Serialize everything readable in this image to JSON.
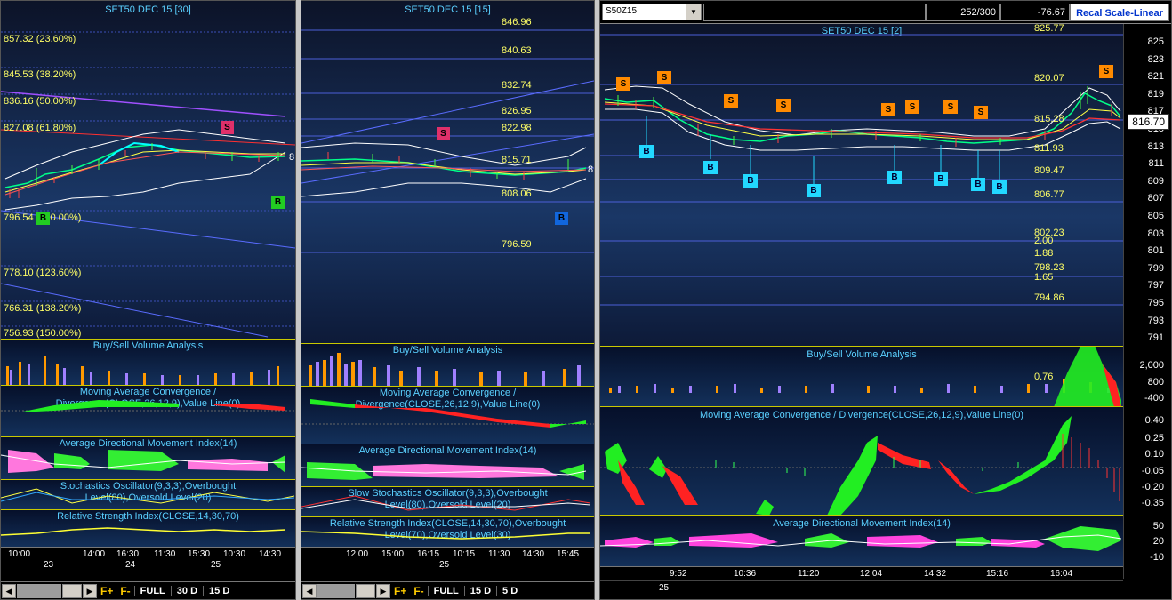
{
  "panel1": {
    "title": "SET50 DEC 15  [30]",
    "fib_levels": [
      "857.32 (23.60%)",
      "845.53 (38.20%)",
      "836.16 (50.00%)",
      "827.08 (61.80%)",
      "796.54 (100.00%)",
      "778.10 (123.60%)",
      "766.31 (138.20%)",
      "756.93 (150.00%)"
    ],
    "subcharts": [
      "Buy/Sell Volume Analysis",
      "Moving Average Convergence / Divergence(CLOSE,26,12,9),Value Line(0)",
      "Average Directional Movement Index(14)",
      "Stochastics Oscillator(9,3,3),Overbought Level(80),Oversold Level(20)",
      "Relative Strength Index(CLOSE,14,30,70)"
    ],
    "time_labels": [
      "10:00",
      "14:00",
      "16:30",
      "11:30",
      "15:30",
      "10:30",
      "14:30"
    ],
    "date_labels": [
      "23",
      "24",
      "25"
    ],
    "toolbar": [
      "FULL",
      "30 D",
      "15 D"
    ],
    "f_plus": "F+",
    "f_minus": "F-",
    "signal_s": "S",
    "signal_b": "B",
    "edge_label": "8"
  },
  "panel2": {
    "title": "SET50 DEC 15  [15]",
    "levels": [
      "846.96",
      "840.63",
      "832.74",
      "826.95",
      "822.98",
      "815.71",
      "808.06",
      "796.59"
    ],
    "subcharts": [
      "Buy/Sell Volume Analysis",
      "Moving Average Convergence / Divergence(CLOSE,26,12,9),Value Line(0)",
      "Average Directional Movement Index(14)",
      "Slow Stochastics Oscillator(9,3,3),Overbought Level(80),Oversold Level(20)",
      "Relative Strength Index(CLOSE,14,30,70),Overbought Level(70),Oversold Level(30)"
    ],
    "time_labels": [
      "12:00",
      "15:00",
      "16:15",
      "10:15",
      "11:30",
      "14:30",
      "15:45"
    ],
    "date_labels": [
      "25"
    ],
    "toolbar": [
      "FULL",
      "15 D",
      "5 D"
    ],
    "f_plus": "F+",
    "f_minus": "F-",
    "signal_s": "S",
    "signal_b": "B",
    "edge_label": "8"
  },
  "panel3": {
    "symbol": "S50Z15",
    "dropdown_arrow": "▼",
    "count": "252/300",
    "change": "-76.67",
    "recal_label": "Recal Scale-Linear",
    "title": "SET50 DEC 15  [2]",
    "levels": [
      "825.77",
      "820.07",
      "815.28",
      "811.93",
      "809.47",
      "806.77",
      "802.23",
      "798.23",
      "794.86"
    ],
    "inline_values": [
      "2.00",
      "1.88",
      "1.65"
    ],
    "price_tag": "816.70",
    "price_scale": [
      "825",
      "823",
      "821",
      "819",
      "817",
      "815",
      "813",
      "811",
      "809",
      "807",
      "805",
      "803",
      "801",
      "799",
      "797",
      "795",
      "793",
      "791"
    ],
    "volume_title": "Buy/Sell Volume Analysis",
    "volume_value": "0.76",
    "volume_scale": [
      "2,000",
      "800",
      "-400"
    ],
    "macd_title": "Moving Average Convergence / Divergence(CLOSE,26,12,9),Value Line(0)",
    "macd_scale": [
      "0.40",
      "0.25",
      "0.10",
      "-0.05",
      "-0.20",
      "-0.35"
    ],
    "adx_title": "Average Directional Movement Index(14)",
    "adx_scale": [
      "50",
      "20",
      "-10"
    ],
    "time_labels": [
      "9:52",
      "10:36",
      "11:20",
      "12:04",
      "14:32",
      "15:16",
      "16:04"
    ],
    "date_labels": [
      "25"
    ],
    "signal_s": "S",
    "signal_b": "B"
  },
  "colors": {
    "fib": "#ffff66",
    "title": "#5ad0ff",
    "sell": "#ff8a00",
    "buy": "#22d8ff",
    "recal": "#0033cc"
  }
}
